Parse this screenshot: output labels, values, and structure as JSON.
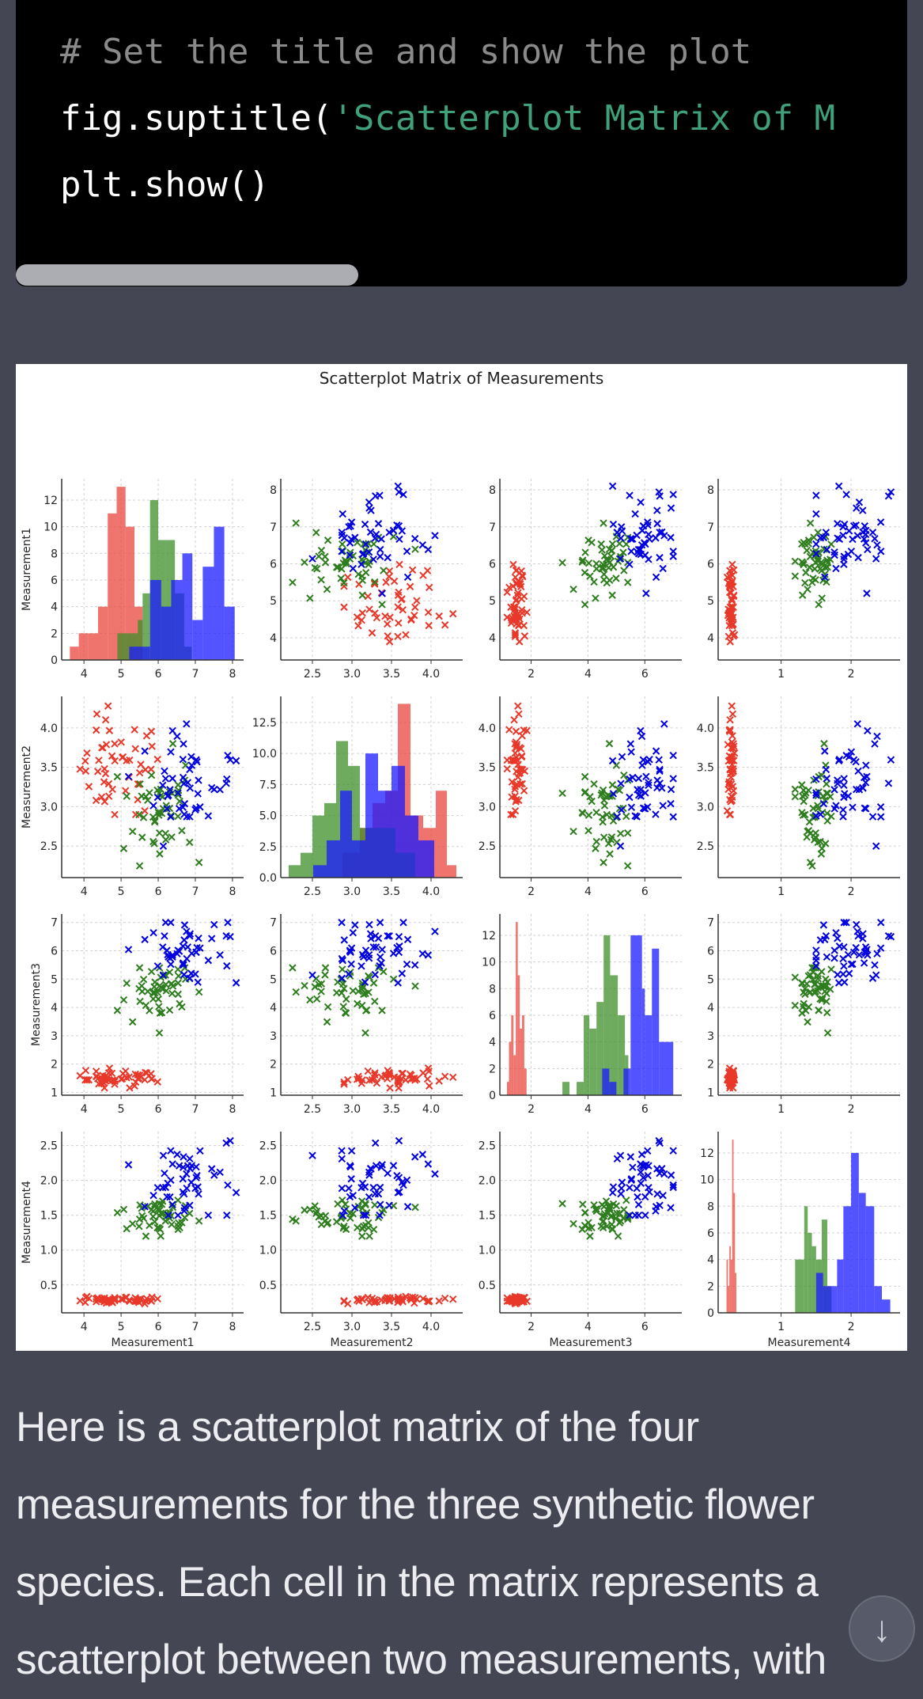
{
  "code": {
    "comment_line": "# Set the title and show the plot",
    "suptitle_prefix": "fig.suptitle(",
    "suptitle_string": "'Scatterplot Matrix of M",
    "show_line": "plt.show()"
  },
  "answer": {
    "text": "Here is a scatterplot matrix of the four measurements for the three synthetic flower species. Each cell in the matrix represents a scatterplot between two measurements, with"
  },
  "scroll_button": {
    "icon": "arrow-down-icon",
    "glyph": "↓"
  },
  "chart_data": {
    "type": "scatter",
    "title": "Scatterplot Matrix of Measurements",
    "variables": [
      "Measurement1",
      "Measurement2",
      "Measurement3",
      "Measurement4"
    ],
    "series_colors": {
      "species_a": "#e8382a",
      "species_b": "#2e7d1e",
      "species_c": "#0000e0"
    },
    "hist_colors": {
      "species_a": "#e8463c",
      "species_b": "#3f8f2a",
      "species_c": "#1a1aff"
    },
    "marker": "x",
    "grid": true,
    "axes": {
      "Measurement1": {
        "range": [
          3.4,
          8.3
        ],
        "ticks": [
          4,
          5,
          6,
          7,
          8
        ],
        "tick_labels": [
          "4",
          "5",
          "6",
          "7",
          "8"
        ]
      },
      "Measurement2": {
        "range": [
          2.1,
          4.4
        ],
        "ticks": [
          2.5,
          3.0,
          3.5,
          4.0
        ],
        "tick_labels": [
          "2.5",
          "3.0",
          "3.5",
          "4.0"
        ]
      },
      "Measurement3": {
        "range": [
          0.9,
          7.3
        ],
        "ticks": [
          2,
          4,
          6
        ],
        "tick_labels": [
          "2",
          "4",
          "6"
        ],
        "y_ticks": [
          1,
          2,
          3,
          4,
          5,
          6,
          7
        ],
        "y_tick_labels": [
          "1",
          "2",
          "3",
          "4",
          "5",
          "6",
          "7"
        ]
      },
      "Measurement4": {
        "range": [
          0.1,
          2.7
        ],
        "ticks": [
          1,
          2
        ],
        "tick_labels": [
          "1",
          "2"
        ],
        "y_ticks": [
          0.5,
          1.0,
          1.5,
          2.0,
          2.5
        ],
        "y_tick_labels": [
          "0.5",
          "1.0",
          "1.5",
          "2.0",
          "2.5"
        ]
      }
    },
    "y_ticks_for_rows": {
      "Measurement1": {
        "ticks": [
          4,
          5,
          6,
          7,
          8
        ],
        "labels": [
          "4",
          "5",
          "6",
          "7",
          "8"
        ],
        "range": [
          3.4,
          8.3
        ]
      },
      "Measurement2": {
        "ticks": [
          2.5,
          3.0,
          3.5,
          4.0
        ],
        "labels": [
          "2.5",
          "3.0",
          "3.5",
          "4.0"
        ],
        "range": [
          2.1,
          4.4
        ]
      },
      "Measurement3": {
        "ticks": [
          1,
          2,
          3,
          4,
          5,
          6,
          7
        ],
        "labels": [
          "1",
          "2",
          "3",
          "4",
          "5",
          "6",
          "7"
        ],
        "range": [
          0.9,
          7.3
        ]
      },
      "Measurement4": {
        "ticks": [
          0.5,
          1.0,
          1.5,
          2.0,
          2.5
        ],
        "labels": [
          "0.5",
          "1.0",
          "1.5",
          "2.0",
          "2.5"
        ],
        "range": [
          0.1,
          2.7
        ]
      }
    },
    "histograms": {
      "Measurement1": {
        "y_ticks": [
          0,
          2,
          4,
          6,
          8,
          10,
          12
        ],
        "y_tick_labels": [
          "0",
          "2",
          "4",
          "6",
          "8",
          "10",
          "12"
        ],
        "ylim": [
          0,
          13.6
        ],
        "series": [
          {
            "name": "species_a",
            "bin_edges": [
              3.62,
              3.86,
              4.12,
              4.38,
              4.64,
              4.88,
              5.12,
              5.36,
              5.58
            ],
            "counts": [
              1,
              2,
              2,
              4,
              11,
              13,
              10,
              4
            ]
          },
          {
            "name": "species_b",
            "bin_edges": [
              4.9,
              5.2,
              5.45,
              5.58,
              5.78,
              6.0,
              6.2,
              6.45,
              6.7,
              6.9
            ],
            "counts": [
              2,
              2,
              3,
              5,
              12,
              9,
              9,
              5,
              1
            ]
          },
          {
            "name": "species_c",
            "bin_edges": [
              5.22,
              5.5,
              5.78,
              6.08,
              6.35,
              6.65,
              6.92,
              7.2,
              7.5,
              7.78,
              8.06
            ],
            "counts": [
              1,
              1,
              6,
              4,
              6,
              8,
              3,
              7,
              10,
              4
            ]
          }
        ]
      },
      "Measurement2": {
        "y_ticks": [
          0.0,
          2.5,
          5.0,
          7.5,
          10.0,
          12.5
        ],
        "y_tick_labels": [
          "0.0",
          "2.5",
          "5.0",
          "7.5",
          "10.0",
          "12.5"
        ],
        "ylim": [
          0,
          14.6
        ],
        "series": [
          {
            "name": "species_a",
            "bin_edges": [
              2.88,
              3.1,
              3.26,
              3.42,
              3.58,
              3.74,
              3.9,
              4.06,
              4.2,
              4.32
            ],
            "counts": [
              2,
              4,
              6,
              7,
              14,
              5,
              4,
              7,
              1
            ]
          },
          {
            "name": "species_b",
            "bin_edges": [
              2.2,
              2.35,
              2.5,
              2.65,
              2.8,
              2.95,
              3.1,
              3.25,
              3.4,
              3.55,
              3.7,
              3.8
            ],
            "counts": [
              1,
              2,
              5,
              6,
              11,
              9,
              4,
              4,
              4,
              2,
              2
            ]
          },
          {
            "name": "species_c",
            "bin_edges": [
              2.51,
              2.68,
              2.85,
              3.0,
              3.17,
              3.33,
              3.5,
              3.67,
              3.84,
              4.04
            ],
            "counts": [
              1,
              3,
              7,
              3,
              10,
              7,
              9,
              5,
              3
            ]
          }
        ]
      },
      "Measurement3": {
        "y_ticks": [
          0,
          2,
          4,
          6,
          8,
          10,
          12
        ],
        "y_tick_labels": [
          "0",
          "2",
          "4",
          "6",
          "8",
          "10",
          "12"
        ],
        "ylim": [
          0,
          13.6
        ],
        "series": [
          {
            "name": "species_a",
            "bin_edges": [
              1.15,
              1.22,
              1.3,
              1.38,
              1.46,
              1.53,
              1.6,
              1.68,
              1.76,
              1.84
            ],
            "counts": [
              1,
              4,
              6,
              3,
              13,
              9,
              5,
              6,
              2
            ]
          },
          {
            "name": "species_b",
            "bin_edges": [
              3.1,
              3.35,
              3.6,
              3.85,
              4.05,
              4.3,
              4.55,
              4.78,
              5.05,
              5.3,
              5.42
            ],
            "counts": [
              1,
              0,
              1,
              6,
              5,
              7,
              12,
              9,
              6,
              3
            ]
          },
          {
            "name": "species_c",
            "bin_edges": [
              4.5,
              4.75,
              5.0,
              5.25,
              5.5,
              5.9,
              6.0,
              6.25,
              6.5,
              7.0
            ],
            "counts": [
              2,
              1,
              0,
              2,
              12,
              8,
              6,
              11,
              4
            ]
          }
        ]
      },
      "Measurement4": {
        "y_ticks": [
          0,
          2,
          4,
          6,
          8,
          10,
          12
        ],
        "y_tick_labels": [
          "0",
          "2",
          "4",
          "6",
          "8",
          "10",
          "12"
        ],
        "ylim": [
          0,
          13.6
        ],
        "series": [
          {
            "name": "species_a",
            "bin_edges": [
              0.22,
              0.24,
              0.26,
              0.28,
              0.3,
              0.32,
              0.34
            ],
            "counts": [
              4,
              2,
              5,
              4,
              13,
              9,
              3,
              7
            ]
          },
          {
            "name": "species_b",
            "bin_edges": [
              1.2,
              1.33,
              1.38,
              1.44,
              1.5,
              1.58,
              1.66,
              1.72
            ],
            "counts": [
              4,
              8,
              6,
              5,
              4,
              7,
              2
            ]
          },
          {
            "name": "species_c",
            "bin_edges": [
              1.5,
              1.6,
              1.7,
              1.8,
              1.89,
              2.0,
              2.11,
              2.21,
              2.33,
              2.44,
              2.56
            ],
            "counts": [
              3,
              2,
              2,
              4,
              8,
              12,
              9,
              8,
              2,
              1
            ]
          }
        ]
      }
    },
    "species_summary": {
      "species_a": {
        "Measurement1": [
          3.6,
          6.1
        ],
        "Measurement2": [
          2.9,
          4.3
        ],
        "Measurement3": [
          1.15,
          1.9
        ],
        "Measurement4": [
          0.22,
          0.34
        ],
        "center": [
          5.0,
          3.5,
          1.5,
          0.28
        ]
      },
      "species_b": {
        "Measurement1": [
          4.9,
          7.1
        ],
        "Measurement2": [
          2.2,
          3.8
        ],
        "Measurement3": [
          3.1,
          5.4
        ],
        "Measurement4": [
          1.2,
          1.85
        ],
        "center": [
          6.0,
          3.0,
          4.6,
          1.5
        ]
      },
      "species_c": {
        "Measurement1": [
          5.2,
          8.1
        ],
        "Measurement2": [
          2.5,
          4.05
        ],
        "Measurement3": [
          4.5,
          7.0
        ],
        "Measurement4": [
          1.5,
          2.6
        ],
        "center": [
          6.8,
          3.3,
          6.0,
          2.0
        ]
      }
    },
    "n_per_species": 50,
    "diagonal": "histogram",
    "x_labels_bottom_row": [
      "Measurement1",
      "Measurement2",
      "Measurement3",
      "Measurement4"
    ],
    "y_labels_left_column": [
      "Measurement1",
      "Measurement2",
      "Measurement3",
      "Measurement4"
    ]
  }
}
